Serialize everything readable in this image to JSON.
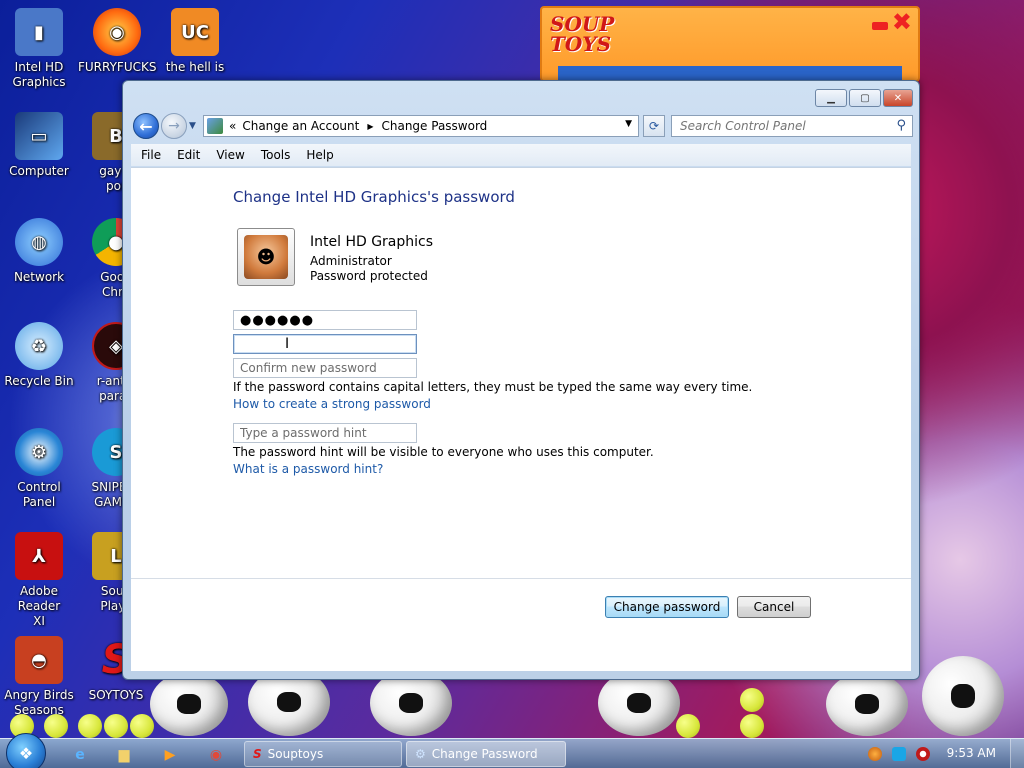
{
  "desktop_icons": [
    {
      "label": "Intel HD\nGraphics",
      "icon": "intel-graphics-icon",
      "color": "#4a78c8"
    },
    {
      "label": "FURRYFUCKS",
      "icon": "firefox-icon",
      "color": "#ff7a1a"
    },
    {
      "label": "the hell is",
      "icon": "uc-browser-icon",
      "color": "#f08a24"
    },
    {
      "label": "Computer",
      "icon": "computer-icon",
      "color": "#3a7bd5"
    },
    {
      "label": "gay fi\npor",
      "icon": "game-icon",
      "color": "#8a6a2a"
    },
    {
      "label": "Network",
      "icon": "network-icon",
      "color": "#2f8ae6"
    },
    {
      "label": "Goog\nChro",
      "icon": "chrome-icon",
      "color": "#2aa34a"
    },
    {
      "label": "Recycle Bin",
      "icon": "recycle-bin-icon",
      "color": "#5aa6e6"
    },
    {
      "label": "r-antiv\nparac",
      "icon": "antivirus-icon",
      "color": "#c01a1a"
    },
    {
      "label": "Control Panel",
      "icon": "control-panel-icon",
      "color": "#2a86d6"
    },
    {
      "label": "SNIPED!\nGAMER",
      "icon": "skype-icon",
      "color": "#1a9ad6"
    },
    {
      "label": "Adobe Reader\nXI",
      "icon": "adobe-reader-icon",
      "color": "#c81010"
    },
    {
      "label": "Soup\nPlays",
      "icon": "souptoys-icon",
      "color": "#c8a020"
    },
    {
      "label": "Angry Birds\nSeasons",
      "icon": "angry-birds-icon",
      "color": "#c84020"
    },
    {
      "label": "SOYTOYS",
      "icon": "souptoys-logo-icon",
      "color": "#e01818"
    }
  ],
  "souptoys_window": {
    "logo": "SOUP\nTOYS"
  },
  "window": {
    "address": {
      "chevron": "«",
      "crumb1": "Change an Account",
      "crumb2": "Change Password"
    },
    "search_placeholder": "Search Control Panel",
    "menu": [
      "File",
      "Edit",
      "View",
      "Tools",
      "Help"
    ],
    "page_title": "Change Intel HD Graphics's password",
    "account": {
      "name": "Intel HD Graphics",
      "role": "Administrator",
      "status": "Password protected"
    },
    "fields": {
      "current_password_value": "●●●●●●",
      "new_password_placeholder": "",
      "confirm_placeholder": "Confirm new password",
      "hint_placeholder": "Type a password hint"
    },
    "capital_note": "If the password contains capital letters, they must be typed the same way every time.",
    "strong_password_link": "How to create a strong password",
    "hint_note": "The password hint will be visible to everyone who uses this computer.",
    "hint_link": "What is a password hint?",
    "buttons": {
      "change": "Change password",
      "cancel": "Cancel"
    }
  },
  "taskbar": {
    "tasks": [
      {
        "label": "Souptoys",
        "icon": "souptoys-icon"
      },
      {
        "label": "Change Password",
        "icon": "control-panel-icon"
      }
    ],
    "clock": "9:53 AM"
  }
}
